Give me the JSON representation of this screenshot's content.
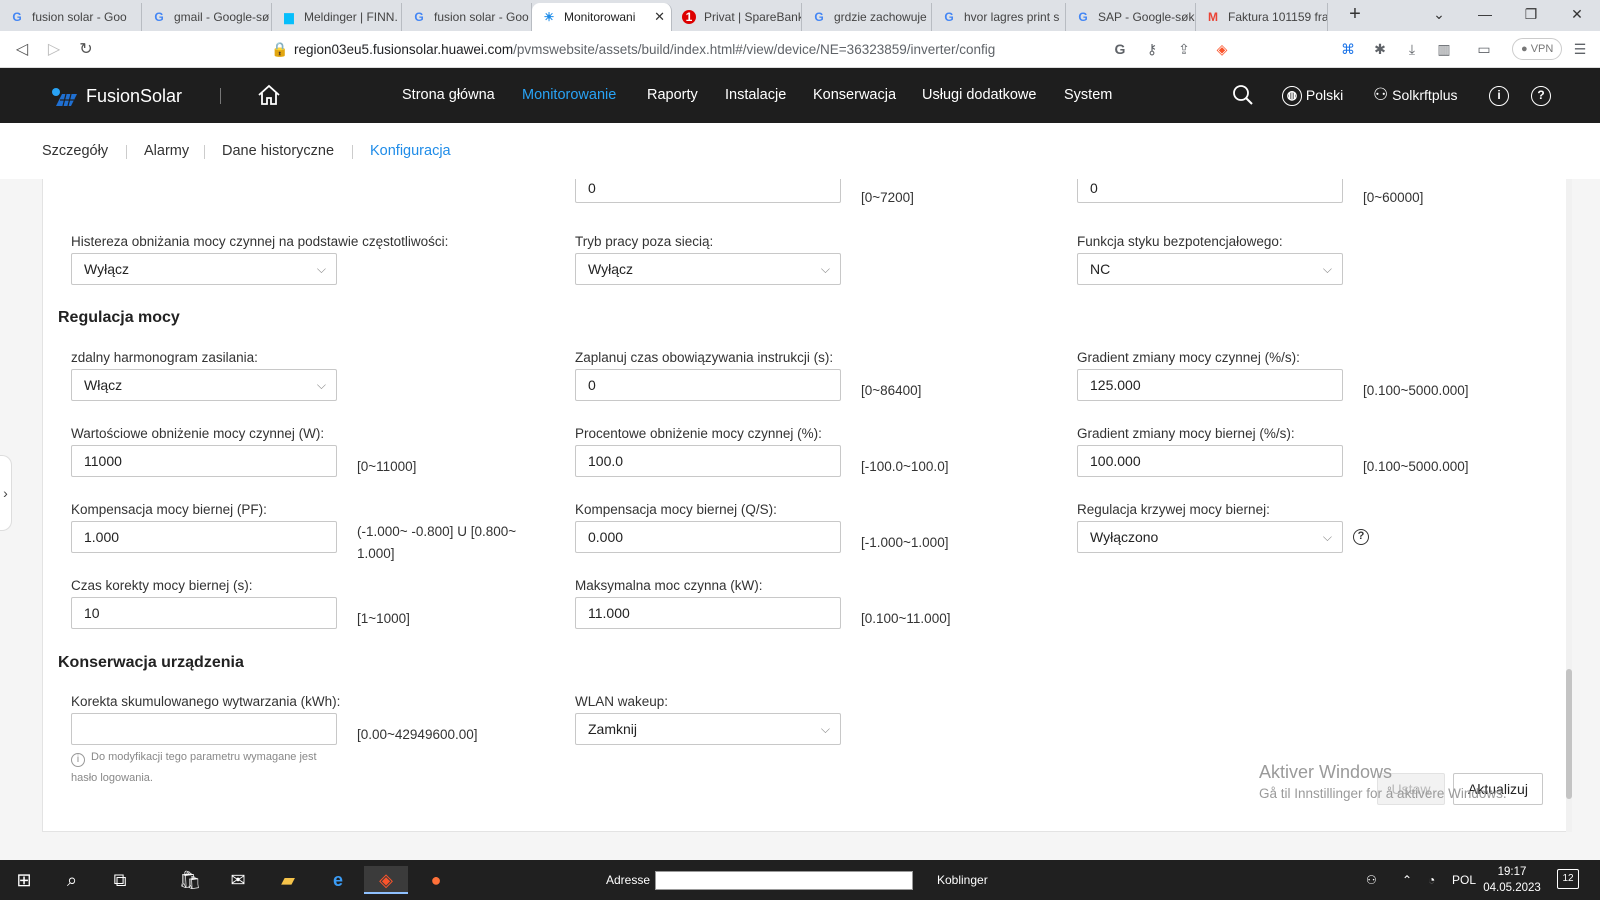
{
  "browser": {
    "tabs": [
      {
        "icon": "google-icon",
        "title": "fusion solar - Goo",
        "active": false
      },
      {
        "icon": "google-icon",
        "title": "gmail - Google-sø",
        "active": false
      },
      {
        "icon": "finn-icon",
        "title": "Meldinger | FINN.",
        "active": false
      },
      {
        "icon": "google-icon",
        "title": "fusion solar - Goo",
        "active": false
      },
      {
        "icon": "fusionsolar-icon",
        "title": "Monitorowani",
        "active": true
      },
      {
        "icon": "sparebank-icon",
        "title": "Privat | SpareBank",
        "active": false
      },
      {
        "icon": "google-icon",
        "title": "grdzie zachowuje",
        "active": false
      },
      {
        "icon": "google-icon",
        "title": "hvor lagres print s",
        "active": false
      },
      {
        "icon": "google-icon",
        "title": "SAP - Google-søk",
        "active": false
      },
      {
        "icon": "gmail-icon",
        "title": "Faktura 101159 fra",
        "active": false
      }
    ],
    "url_host": "region03eu5.fusionsolar.huawei.com",
    "url_path": "/pvmswebsite/assets/build/index.html#/view/device/NE=36323859/inverter/config",
    "vpn_label": "VPN"
  },
  "app": {
    "brand": "FusionSolar",
    "nav": [
      {
        "label": "Strona główna",
        "active": false
      },
      {
        "label": "Monitorowanie",
        "active": true
      },
      {
        "label": "Raporty",
        "active": false
      },
      {
        "label": "Instalacje",
        "active": false
      },
      {
        "label": "Konserwacja",
        "active": false
      },
      {
        "label": "Usługi dodatkowe",
        "active": false
      },
      {
        "label": "System",
        "active": false
      }
    ],
    "language": "Polski",
    "user": "Solkrftplus",
    "accent_color": "#1f8ce8"
  },
  "subtabs": [
    {
      "label": "Szczegóły",
      "active": false
    },
    {
      "label": "Alarmy",
      "active": false
    },
    {
      "label": "Dane historyczne",
      "active": false
    },
    {
      "label": "Konfiguracja",
      "active": true
    }
  ],
  "config": {
    "top_partial": {
      "col2_value": "0",
      "col2_range": "[0~7200]",
      "col3_value": "0",
      "col3_range": "[0~60000]"
    },
    "row_hist": {
      "freq_hysteresis": {
        "label": "Histereza obniżania mocy czynnej na podstawie częstotliwości:",
        "value": "Wyłącz"
      },
      "offgrid_mode": {
        "label": "Tryb pracy poza siecią:",
        "value": "Wyłącz"
      },
      "dry_contact": {
        "label": "Funkcja styku bezpotencjałowego:",
        "value": "NC"
      }
    },
    "power_regulation": {
      "title": "Regulacja mocy",
      "remote_schedule": {
        "label": "zdalny harmonogram zasilania:",
        "value": "Włącz"
      },
      "instruction_validity": {
        "label": "Zaplanuj czas obowiązywania instrukcji (s):",
        "value": "0",
        "range": "[0~86400]"
      },
      "active_gradient": {
        "label": "Gradient zmiany mocy czynnej (%/s):",
        "value": "125.000",
        "range": "[0.100~5000.000]"
      },
      "active_derating_w": {
        "label": "Wartościowe obniżenie mocy czynnej (W):",
        "value": "11000",
        "range": "[0~11000]"
      },
      "active_derating_pct": {
        "label": "Procentowe obniżenie mocy czynnej (%):",
        "value": "100.0",
        "range": "[-100.0~100.0]"
      },
      "reactive_gradient": {
        "label": "Gradient zmiany mocy biernej (%/s):",
        "value": "100.000",
        "range": "[0.100~5000.000]"
      },
      "reactive_pf": {
        "label": "Kompensacja mocy biernej (PF):",
        "value": "1.000",
        "range_line1": "(-1.000~ -0.800] U [0.800~",
        "range_line2": "1.000]"
      },
      "reactive_qs": {
        "label": "Kompensacja mocy biernej (Q/S):",
        "value": "0.000",
        "range": "[-1.000~1.000]"
      },
      "reactive_curve": {
        "label": "Regulacja krzywej mocy biernej:",
        "value": "Wyłączono"
      },
      "reactive_correction_time": {
        "label": "Czas korekty mocy biernej (s):",
        "value": "10",
        "range": "[1~1000]"
      },
      "max_active_power": {
        "label": "Maksymalna moc czynna (kW):",
        "value": "11.000",
        "range": "[0.100~11.000]"
      }
    },
    "maintenance": {
      "title": "Konserwacja urządzenia",
      "energy_correction": {
        "label": "Korekta skumulowanego wytwarzania (kWh):",
        "value": "",
        "range": "[0.00~42949600.00]",
        "hint_line1": "Do modyfikacji tego parametru wymagane jest",
        "hint_line2": "hasło logowania."
      },
      "wlan_wakeup": {
        "label": "WLAN wakeup:",
        "value": "Zamknij"
      }
    },
    "buttons": {
      "set": "Ustaw",
      "update": "Aktualizuj"
    },
    "watermark": {
      "line1": "Aktiver Windows",
      "line2": "Gå til Innstillinger for å aktivere Windows."
    }
  },
  "taskbar": {
    "address_label": "Adresse",
    "links_label": "Koblinger",
    "lang": "POL",
    "time": "19:17",
    "date": "04.05.2023",
    "notifications": "12"
  }
}
